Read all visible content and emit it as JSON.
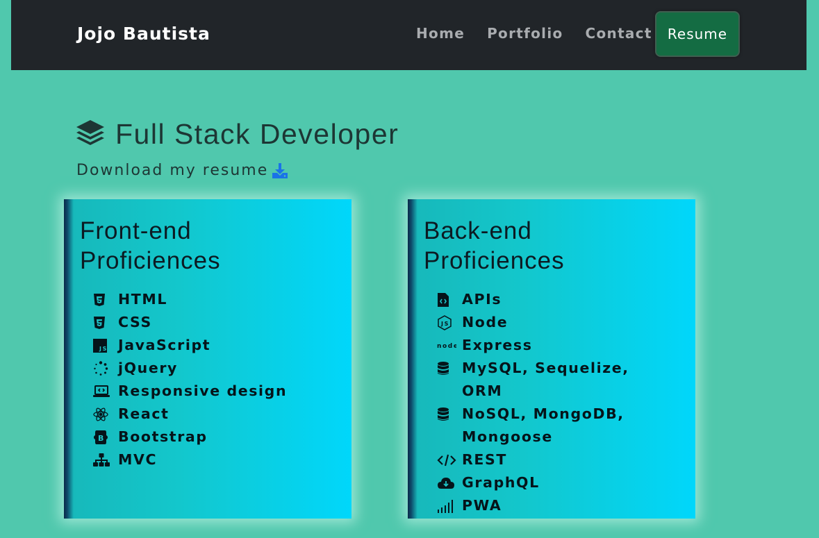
{
  "nav": {
    "brand": "Jojo Bautista",
    "links": [
      "Home",
      "Portfolio",
      "Contact"
    ],
    "resume_button": "Resume"
  },
  "header": {
    "title": "Full Stack Developer",
    "title_icon": "layer-group-icon",
    "download_text": "Download my resume",
    "download_icon": "download-icon"
  },
  "frontend": {
    "title": "Front-end Proficiences",
    "items": [
      {
        "label": "HTML",
        "icon": "html5-icon"
      },
      {
        "label": "CSS",
        "icon": "css3-icon"
      },
      {
        "label": "JavaScript",
        "icon": "js-icon"
      },
      {
        "label": "jQuery",
        "icon": "spinner-icon"
      },
      {
        "label": "Responsive design",
        "icon": "laptop-code-icon"
      },
      {
        "label": "React",
        "icon": "react-icon"
      },
      {
        "label": "Bootstrap",
        "icon": "bootstrap-icon"
      },
      {
        "label": "MVC",
        "icon": "sitemap-icon"
      }
    ]
  },
  "backend": {
    "title": "Back-end Proficiences",
    "items": [
      {
        "label": "APIs",
        "icon": "file-code-icon"
      },
      {
        "label": "Node",
        "icon": "nodejs-icon"
      },
      {
        "label": "Express",
        "icon": "node-logo-icon"
      },
      {
        "label": "MySQL, Sequelize, ORM",
        "icon": "database-icon"
      },
      {
        "label": "NoSQL, MongoDB, Mongoose",
        "icon": "database-icon"
      },
      {
        "label": "REST",
        "icon": "code-icon"
      },
      {
        "label": "GraphQL",
        "icon": "cloud-download-icon"
      },
      {
        "label": "PWA",
        "icon": "signal-icon"
      }
    ]
  },
  "colors": {
    "page_bg": "#50c8ad",
    "navbar_bg": "#212529",
    "resume_button_bg": "#146c43",
    "card_gradient_end": "#00d7fb",
    "download_icon": "#1a73e8"
  }
}
